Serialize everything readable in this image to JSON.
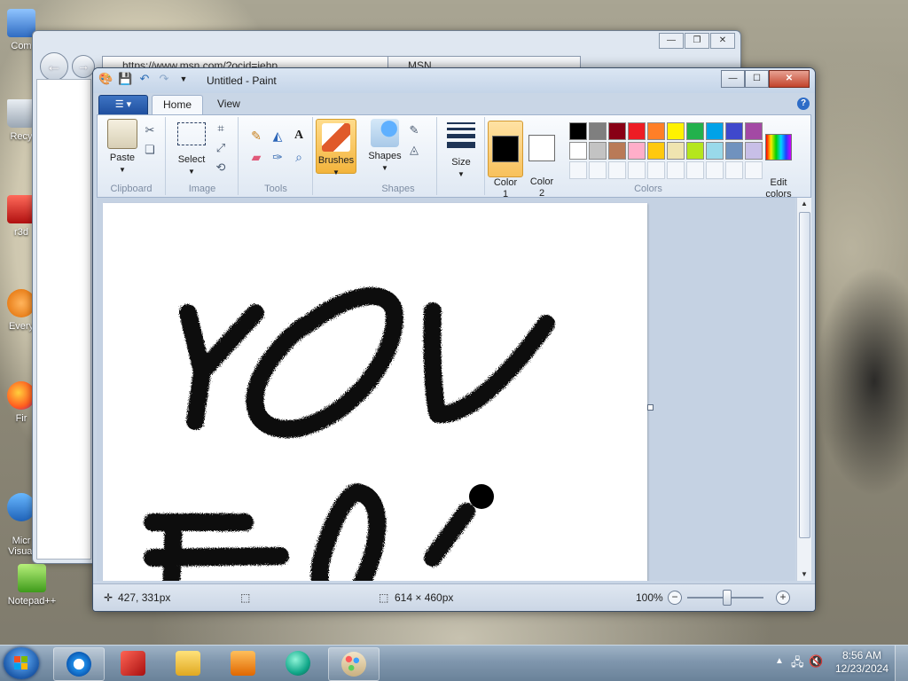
{
  "desktop": {
    "icons": [
      {
        "label": "Com",
        "icon": "computer-icon"
      },
      {
        "label": "Recy",
        "icon": "recycle-bin-icon"
      },
      {
        "label": "r3d",
        "icon": "app-shortcut-icon"
      },
      {
        "label": "Every",
        "icon": "everything-search-icon"
      },
      {
        "label": "Fir",
        "icon": "firefox-icon"
      },
      {
        "label": "Micr\nVisual",
        "icon": "visual-studio-icon"
      },
      {
        "label": "Notepad++",
        "icon": "notepad-plus-plus-icon"
      }
    ]
  },
  "browser": {
    "address": "https://www.msn.com/?ocid=iehp",
    "tab_title": "MSN"
  },
  "paint": {
    "title": "Untitled - Paint",
    "file_menu_label": "",
    "tabs": [
      {
        "label": "Home"
      },
      {
        "label": "View"
      }
    ],
    "clipboard": {
      "paste_label": "Paste",
      "group_label": "Clipboard"
    },
    "image": {
      "select_label": "Select",
      "group_label": "Image"
    },
    "tools": {
      "group_label": "Tools"
    },
    "brushes": {
      "label": "Brushes"
    },
    "shapes": {
      "label": "Shapes",
      "group_label": "Shapes"
    },
    "size": {
      "label": "Size"
    },
    "colors": {
      "color1_label": "Color\n1",
      "color2_label": "Color\n2",
      "color1": "#000000",
      "color2": "#ffffff",
      "edit_label": "Edit\ncolors",
      "group_label": "Colors",
      "palette_row1": [
        "#000000",
        "#7f7f7f",
        "#880015",
        "#ed1c24",
        "#ff7f27",
        "#fff200",
        "#22b14c",
        "#00a2e8",
        "#3f48cc",
        "#a349a4"
      ],
      "palette_row2": [
        "#ffffff",
        "#c3c3c3",
        "#b97a57",
        "#ffaec9",
        "#ffc90e",
        "#efe4b0",
        "#b5e61d",
        "#99d9ea",
        "#7092be",
        "#c8bfe7"
      ]
    },
    "canvas_text": [
      "YOU",
      "HOI"
    ],
    "status": {
      "cursor_pos": "427, 331px",
      "selection_size": "",
      "image_size": "614 × 460px",
      "zoom": "100%"
    }
  },
  "taskbar": {
    "clock_time": "8:56 AM",
    "clock_date": "12/23/2024",
    "items": [
      {
        "name": "internet-explorer"
      },
      {
        "name": "app-red"
      },
      {
        "name": "file-explorer"
      },
      {
        "name": "media-player"
      },
      {
        "name": "app-teal"
      },
      {
        "name": "paint"
      }
    ]
  }
}
